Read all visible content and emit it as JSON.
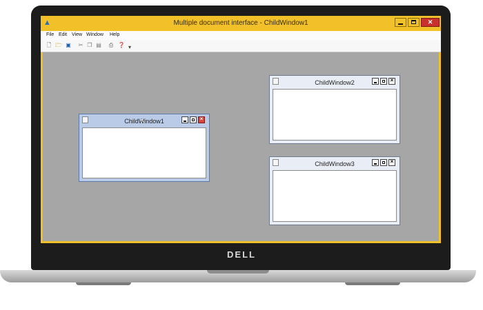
{
  "app": {
    "title": "Multiple document interface - ChildWindow1"
  },
  "menu": [
    "File",
    "Edit",
    "View",
    "Window",
    "Help"
  ],
  "toolbar": {
    "icons": [
      "new-file-icon",
      "open-folder-icon",
      "save-icon",
      "cut-icon",
      "copy-icon",
      "paste-icon",
      "print-icon",
      "help-icon",
      "overflow-chevron-icon"
    ]
  },
  "children": [
    {
      "title": "ChildWindow1"
    },
    {
      "title": "ChildWindow2"
    },
    {
      "title": "ChildWindow3"
    }
  ],
  "device": {
    "brand": "DELL"
  },
  "colors": {
    "title_bar": "#f2c12a",
    "mdi_background": "#a6a6a6",
    "active_child": "#b9cbe6"
  }
}
